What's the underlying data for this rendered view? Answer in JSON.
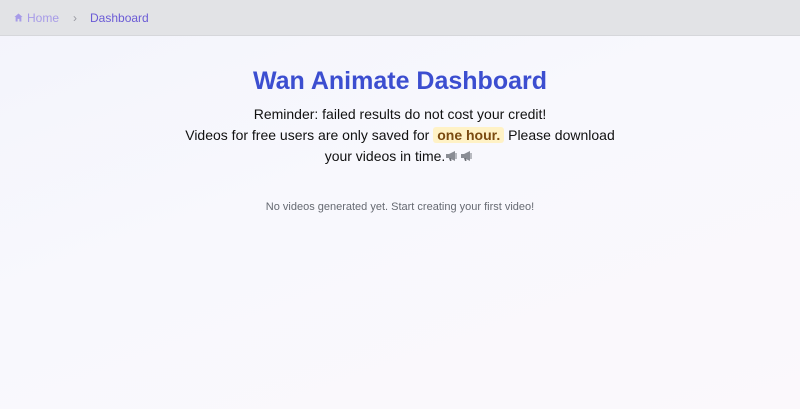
{
  "breadcrumb": {
    "home_label": "Home",
    "separator": "›",
    "current_label": "Dashboard"
  },
  "page": {
    "title": "Wan Animate Dashboard",
    "reminder_line1": "Reminder: failed results do not cost your credit!",
    "reminder_line2_pre": "Videos for free users are only saved for",
    "reminder_highlight": "one hour.",
    "reminder_line2_post": "Please download your videos in time.",
    "empty_state": "No videos generated yet. Start creating your first video!"
  },
  "icons": [
    "home-icon",
    "megaphone-icon",
    "megaphone-icon"
  ],
  "colors": {
    "title": "#3c4ed0",
    "breadcrumb_home": "#a79be8",
    "breadcrumb_current": "#6b5bd6",
    "highlight_bg": "#fff2c6"
  }
}
